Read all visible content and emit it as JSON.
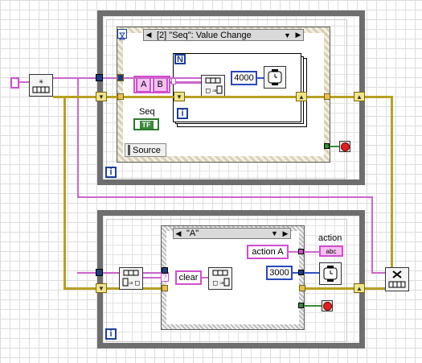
{
  "upper_loop": {
    "event_case_selector": "[2] \"Seq\": Value Change",
    "event_timeout_icon": "hourglass-icon",
    "string_constant_a": "A",
    "string_constant_b": "B",
    "for_loop_count_label": "N",
    "for_loop_iteration_label": "i",
    "wait_ms_value": "4000",
    "seq_label": "Seq",
    "seq_boolean_text": "TF",
    "source_label": "Source",
    "while_iteration_label": "i"
  },
  "lower_loop": {
    "case_selector": "\"A\"",
    "clear_constant": "clear",
    "action_constant": "action A",
    "action_indicator_label": "action",
    "action_indicator_icon": "abc",
    "wait_ms_value": "3000",
    "while_iteration_label": "i",
    "default_marker": "?"
  },
  "queue_functions": {
    "obtain_queue_icon": "obtain-queue-icon",
    "enqueue_icon": "enqueue-icon",
    "dequeue_icon": "dequeue-icon",
    "release_queue_icon": "release-queue-icon"
  }
}
